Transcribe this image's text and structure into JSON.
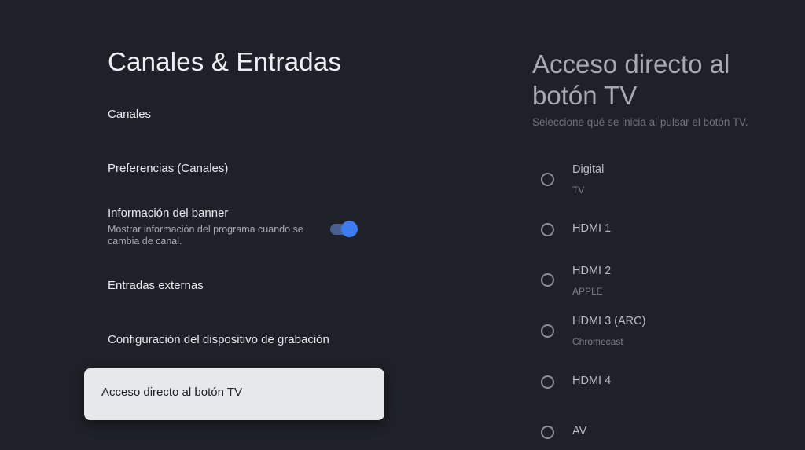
{
  "left_panel": {
    "title": "Canales & Entradas",
    "items": [
      {
        "label": "Canales"
      },
      {
        "label": "Preferencias (Canales)"
      },
      {
        "label": "Información del banner",
        "subtitle": "Mostrar información del programa cuando se cambia de canal.",
        "toggle_on": true
      },
      {
        "label": "Entradas externas"
      },
      {
        "label": "Configuración del dispositivo de grabación"
      },
      {
        "label": "Acceso directo al botón TV",
        "selected": true
      }
    ]
  },
  "right_panel": {
    "title": "Acceso directo al botón TV",
    "description": "Seleccione qué se inicia al pulsar el botón TV.",
    "options": [
      {
        "label": "Digital",
        "subtitle": "TV"
      },
      {
        "label": "HDMI 1",
        "subtitle": ""
      },
      {
        "label": "HDMI 2",
        "subtitle": "APPLE"
      },
      {
        "label": "HDMI 3 (ARC)",
        "subtitle": "Chromecast"
      },
      {
        "label": "HDMI 4",
        "subtitle": ""
      },
      {
        "label": "AV",
        "subtitle": ""
      }
    ]
  },
  "colors": {
    "background": "#1f2128",
    "toggle_accent": "#3d7cf0",
    "selected_card": "#e7e8ec"
  }
}
